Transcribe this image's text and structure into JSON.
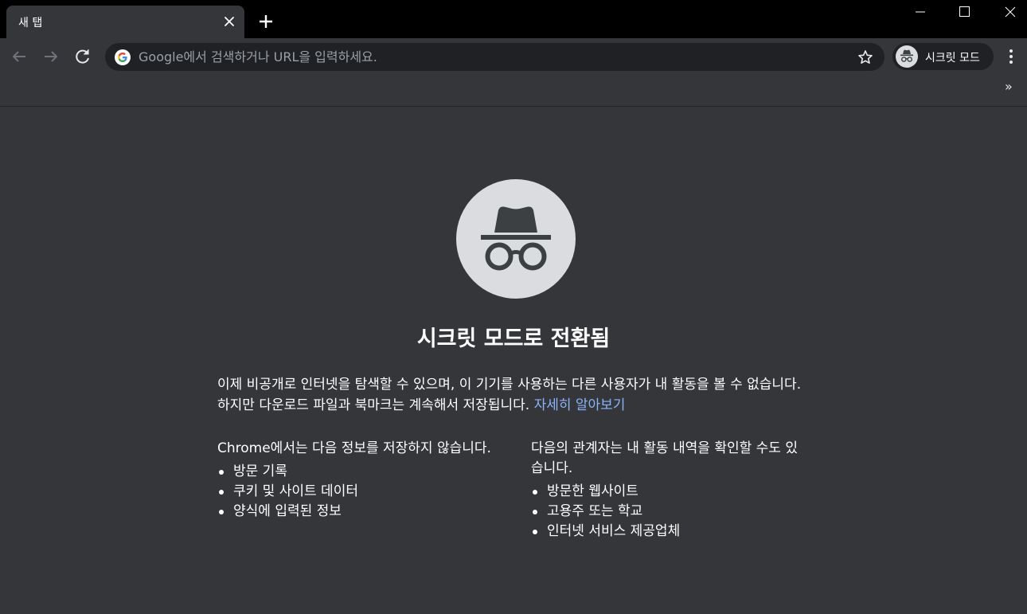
{
  "tab": {
    "title": "새 탭"
  },
  "omnibox": {
    "placeholder": "Google에서 검색하거나 URL을 입력하세요."
  },
  "profile": {
    "label": "시크릿 모드"
  },
  "bookmarks": {
    "more": "»"
  },
  "page": {
    "heading": "시크릿 모드로 전환됨",
    "description": "이제 비공개로 인터넷을 탐색할 수 있으며, 이 기기를 사용하는 다른 사용자가 내 활동을 볼 수 없습니다. 하지만 다운로드 파일과 북마크는 계속해서 저장됩니다.",
    "learn_more": "자세히 알아보기",
    "left_column": {
      "title": "Chrome에서는 다음 정보를 저장하지 않습니다.",
      "items": [
        "방문 기록",
        "쿠키 및 사이트 데이터",
        "양식에 입력된 정보"
      ]
    },
    "right_column": {
      "title": "다음의 관계자는 내 활동 내역을 확인할 수도 있습니다.",
      "items": [
        "방문한 웹사이트",
        "고용주 또는 학교",
        "인터넷 서비스 제공업체"
      ]
    }
  },
  "icons": {
    "tab_close": "close-icon",
    "new_tab": "plus-icon",
    "back": "arrow-back-icon",
    "forward": "arrow-forward-icon",
    "reload": "reload-icon",
    "google": "google-g-icon",
    "star": "star-icon",
    "incognito": "incognito-icon",
    "menu": "more-vert-icon"
  },
  "colors": {
    "background": "#35363a",
    "omnibox": "#202124",
    "link": "#8ab4f8",
    "hero_circle": "#dadce0",
    "tabstrip": "#000000"
  }
}
